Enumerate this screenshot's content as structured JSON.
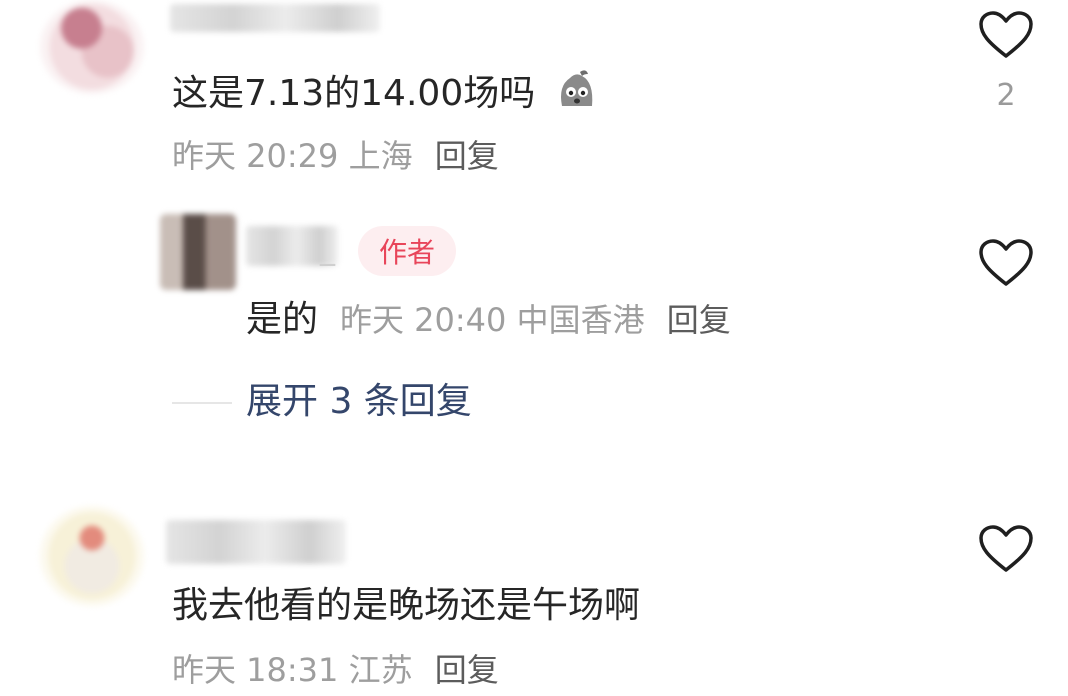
{
  "comments": [
    {
      "text": "这是7.13的14.00场吗",
      "emoji": "sweating-face-emoji",
      "time": "昨天 20:29",
      "location": "上海",
      "reply_label": "回复",
      "likes": "2"
    },
    {
      "text": "我去他看的是晚场还是午场啊",
      "time": "昨天 18:31",
      "location": "江苏",
      "reply_label": "回复"
    }
  ],
  "reply": {
    "name_suffix": "_",
    "author_badge": "作者",
    "text": "是的",
    "time": "昨天 20:40",
    "location": "中国香港",
    "reply_label": "回复"
  },
  "expand_replies": "展开 3 条回复",
  "icons": {
    "like": "heart-outline-icon"
  },
  "colors": {
    "author_badge_text": "#e8455a",
    "author_badge_bg": "#fdeef0",
    "expand_link": "#34466b"
  }
}
